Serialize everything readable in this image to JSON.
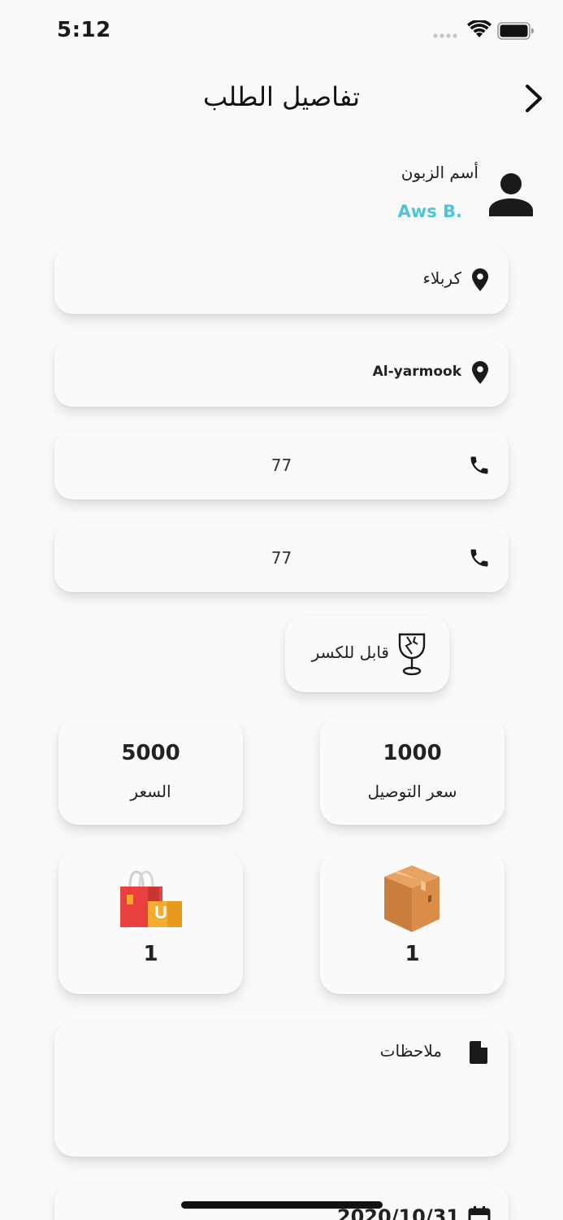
{
  "status_bar": {
    "time": "5:12"
  },
  "header": {
    "title": "تفاصيل الطلب"
  },
  "customer": {
    "label": "أسم الزبون",
    "name": "Aws B."
  },
  "fields": {
    "city": "كربلاء",
    "area": "Al-yarmook",
    "phone_1": "77",
    "phone_2": "77"
  },
  "fragile": {
    "label": "قابل للكسر"
  },
  "stats": {
    "delivery_price_value": "1000",
    "delivery_price_label": "سعر التوصيل",
    "price_value": "5000",
    "price_label": "السعر"
  },
  "counts": {
    "box_count": "1",
    "bag_count": "1"
  },
  "notes": {
    "label": "ملاحظات"
  },
  "date": {
    "value": "2020/10/31"
  },
  "colors": {
    "accent": "#4ec3dc",
    "card_bg": "#fafafa",
    "page_bg": "#f9f9f9"
  },
  "icons": [
    "back-chevron-icon",
    "person-icon",
    "location-pin-icon",
    "phone-icon",
    "fragile-glass-icon",
    "box-icon",
    "shopping-bag-icon",
    "document-icon",
    "calendar-icon"
  ]
}
